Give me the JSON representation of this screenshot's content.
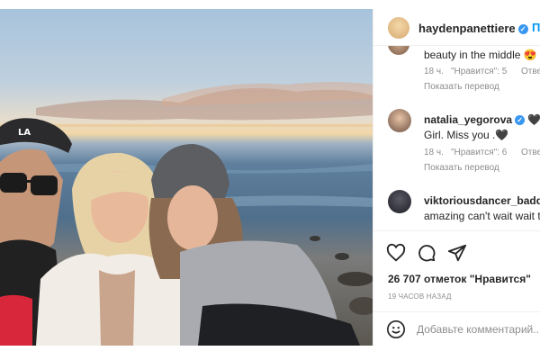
{
  "post": {
    "author": "haydenpanettiere",
    "follow_label": "П"
  },
  "comments": [
    {
      "username": "",
      "text": "beauty in the middle 😍",
      "time": "18 ч.",
      "likes": "\"Нравится\": 5",
      "reply": "Отве",
      "translate": "Показать перевод"
    },
    {
      "username": "natalia_yegorova",
      "text_prefix": "🖤 G",
      "text": "Girl. Miss you .🖤",
      "time": "18 ч.",
      "likes": "\"Нравится\": 6",
      "reply": "Отве",
      "translate": "Показать перевод"
    },
    {
      "username": "viktoriousdancer_baddes",
      "text": "amazing can't wait wait t"
    }
  ],
  "actions": {
    "likes_count": "26 707 отметок \"Нравится\"",
    "time_ago": "19 ЧАСОВ НАЗАД",
    "add_comment_placeholder": "Добавьте комментарий..."
  },
  "icons": [
    "verified-badge-icon",
    "heart-icon",
    "comment-icon",
    "share-icon",
    "emoji-icon"
  ],
  "colors": {
    "accent": "#0095f6",
    "verified": "#3897f0",
    "meta": "#8e8e8e"
  }
}
